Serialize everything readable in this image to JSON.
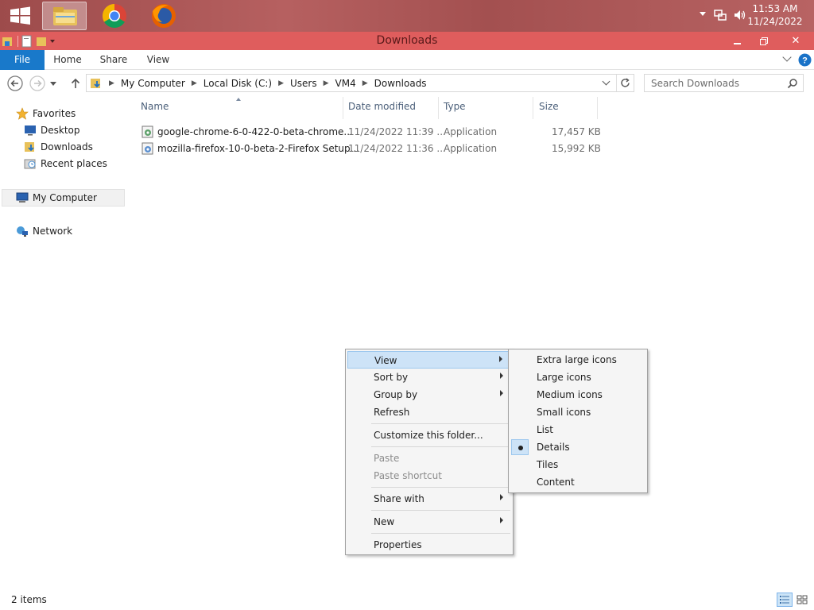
{
  "taskbar": {
    "apps": [
      {
        "name": "file-explorer",
        "active": true
      },
      {
        "name": "chrome",
        "active": false
      },
      {
        "name": "firefox",
        "active": false
      }
    ],
    "clock_time": "11:53 AM",
    "clock_date": "11/24/2022"
  },
  "window": {
    "title": "Downloads"
  },
  "ribbon": {
    "tabs": [
      "File",
      "Home",
      "Share",
      "View"
    ]
  },
  "address": {
    "crumbs": [
      "My Computer",
      "Local Disk (C:)",
      "Users",
      "VM4",
      "Downloads"
    ],
    "search_placeholder": "Search Downloads"
  },
  "nav": {
    "favorites": "Favorites",
    "desktop": "Desktop",
    "downloads": "Downloads",
    "recent": "Recent places",
    "computer": "My Computer",
    "network": "Network"
  },
  "columns": {
    "name": "Name",
    "date": "Date modified",
    "type": "Type",
    "size": "Size"
  },
  "files": [
    {
      "name": "google-chrome-6-0-422-0-beta-chrome...",
      "date": "11/24/2022 11:39 ...",
      "type": "Application",
      "size": "17,457 KB"
    },
    {
      "name": "mozilla-firefox-10-0-beta-2-Firefox Setup...",
      "date": "11/24/2022 11:36 ...",
      "type": "Application",
      "size": "15,992 KB"
    }
  ],
  "status": {
    "count": "2 items"
  },
  "context_menu": {
    "view": "View",
    "sort_by": "Sort by",
    "group_by": "Group by",
    "refresh": "Refresh",
    "customize": "Customize this folder...",
    "paste": "Paste",
    "paste_shortcut": "Paste shortcut",
    "share_with": "Share with",
    "new": "New",
    "properties": "Properties"
  },
  "view_submenu": {
    "items": [
      "Extra large icons",
      "Large icons",
      "Medium icons",
      "Small icons",
      "List",
      "Details",
      "Tiles",
      "Content"
    ],
    "selected": "Details"
  }
}
